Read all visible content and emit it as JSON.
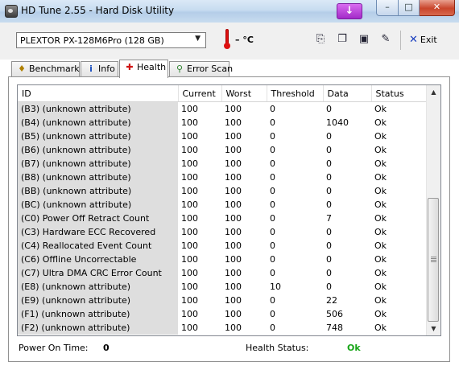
{
  "window": {
    "title": "HD Tune 2.55 - Hard Disk Utility",
    "min": "–",
    "max": "□",
    "close": "✕",
    "download": "↓"
  },
  "toolbar": {
    "drive": "PLEXTOR PX-128M6Pro (128 GB)",
    "temperature": "– °C",
    "exit_label": "Exit"
  },
  "tabs": [
    {
      "label": "Benchmark",
      "icon": "gauge-icon"
    },
    {
      "label": "Info",
      "icon": "info-icon"
    },
    {
      "label": "Health",
      "icon": "health-cross-icon",
      "active": true
    },
    {
      "label": "Error Scan",
      "icon": "magnifier-icon"
    }
  ],
  "table": {
    "columns": [
      "ID",
      "Current",
      "Worst",
      "Threshold",
      "Data",
      "Status"
    ],
    "rows": [
      [
        "(B3) (unknown attribute)",
        "100",
        "100",
        "0",
        "0",
        "Ok"
      ],
      [
        "(B4) (unknown attribute)",
        "100",
        "100",
        "0",
        "1040",
        "Ok"
      ],
      [
        "(B5) (unknown attribute)",
        "100",
        "100",
        "0",
        "0",
        "Ok"
      ],
      [
        "(B6) (unknown attribute)",
        "100",
        "100",
        "0",
        "0",
        "Ok"
      ],
      [
        "(B7) (unknown attribute)",
        "100",
        "100",
        "0",
        "0",
        "Ok"
      ],
      [
        "(B8) (unknown attribute)",
        "100",
        "100",
        "0",
        "0",
        "Ok"
      ],
      [
        "(BB) (unknown attribute)",
        "100",
        "100",
        "0",
        "0",
        "Ok"
      ],
      [
        "(BC) (unknown attribute)",
        "100",
        "100",
        "0",
        "0",
        "Ok"
      ],
      [
        "(C0) Power Off Retract Count",
        "100",
        "100",
        "0",
        "7",
        "Ok"
      ],
      [
        "(C3) Hardware ECC Recovered",
        "100",
        "100",
        "0",
        "0",
        "Ok"
      ],
      [
        "(C4) Reallocated Event Count",
        "100",
        "100",
        "0",
        "0",
        "Ok"
      ],
      [
        "(C6) Offline Uncorrectable",
        "100",
        "100",
        "0",
        "0",
        "Ok"
      ],
      [
        "(C7) Ultra DMA CRC Error Count",
        "100",
        "100",
        "0",
        "0",
        "Ok"
      ],
      [
        "(E8) (unknown attribute)",
        "100",
        "100",
        "10",
        "0",
        "Ok"
      ],
      [
        "(E9) (unknown attribute)",
        "100",
        "100",
        "0",
        "22",
        "Ok"
      ],
      [
        "(F1) (unknown attribute)",
        "100",
        "100",
        "0",
        "506",
        "Ok"
      ],
      [
        "(F2) (unknown attribute)",
        "100",
        "100",
        "0",
        "748",
        "Ok"
      ]
    ]
  },
  "footer": {
    "power_on_label": "Power On Time:",
    "power_on_value": "0",
    "health_label": "Health Status:",
    "health_value": "Ok"
  }
}
